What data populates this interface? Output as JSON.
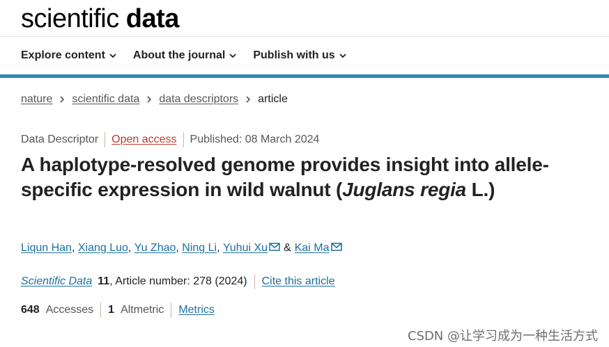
{
  "header": {
    "logo_light": "scientific ",
    "logo_bold": "data",
    "nav": [
      {
        "label": "Explore content"
      },
      {
        "label": "About the journal"
      },
      {
        "label": "Publish with us"
      }
    ]
  },
  "breadcrumb": {
    "items": [
      "nature",
      "scientific data",
      "data descriptors"
    ],
    "current": "article"
  },
  "meta": {
    "type": "Data Descriptor",
    "open_access": "Open access",
    "published": "Published: 08 March 2024"
  },
  "title": {
    "part1": "A haplotype-resolved genome provides insight into allele-specific expression in wild walnut (",
    "italic": "Juglans regia",
    "part2": " L.)"
  },
  "authors": {
    "list": [
      "Liqun Han",
      "Xiang Luo",
      "Yu Zhao",
      "Ning Li",
      "Yuhui Xu",
      "Kai Ma"
    ],
    "amp": "&"
  },
  "journal": {
    "name": "Scientific Data",
    "volume": "11",
    "rest": ", Article number: 278 (2024)",
    "cite": "Cite this article"
  },
  "metrics": {
    "accesses_count": "648",
    "accesses_label": "Accesses",
    "altmetric_count": "1",
    "altmetric_label": "Altmetric",
    "link": "Metrics"
  },
  "watermark": "CSDN @让学习成为一种生活方式",
  "colors": {
    "accent_bar": "#2b8bb1",
    "link": "#1a6fa0",
    "open_access": "#c0392b"
  }
}
